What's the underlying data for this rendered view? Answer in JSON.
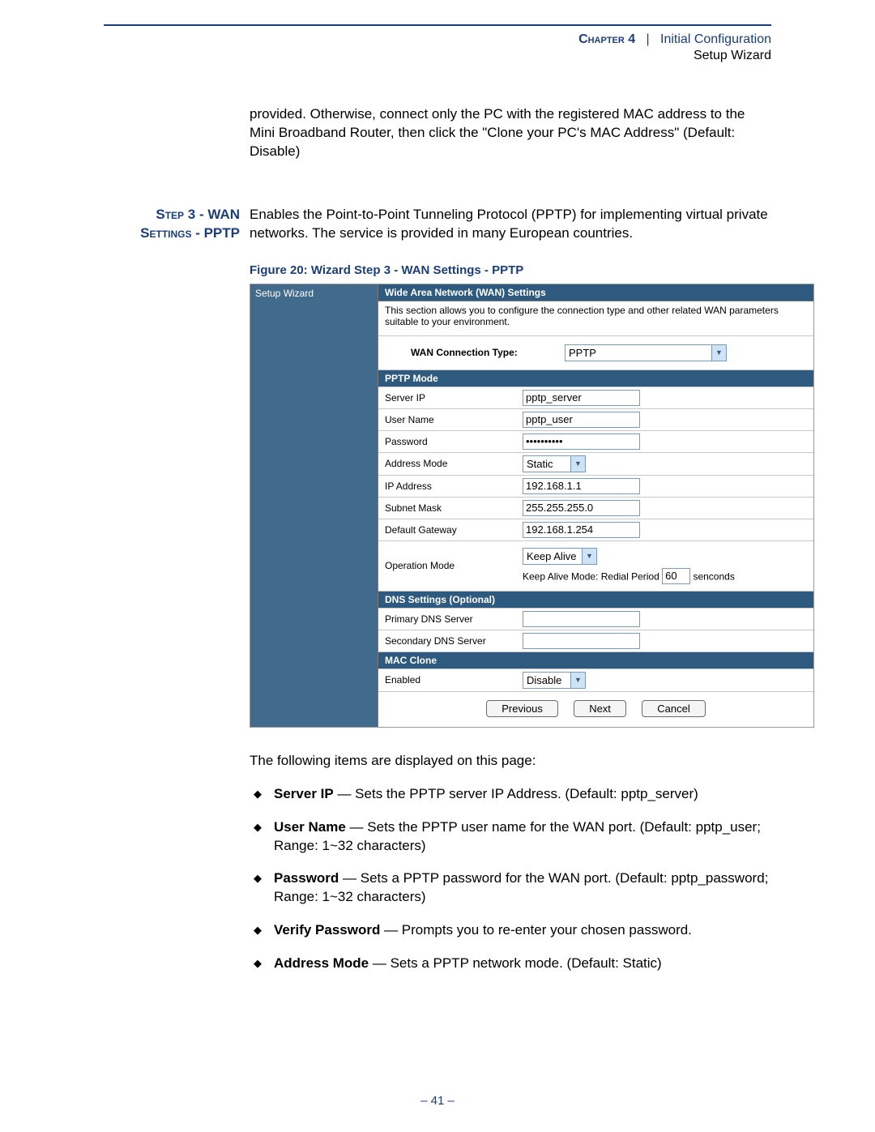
{
  "header": {
    "chapter_label": "Chapter 4",
    "chapter_sep": "|",
    "chapter_title": "Initial Configuration",
    "sub": "Setup Wizard"
  },
  "intro_para": "provided. Otherwise, connect only the PC with the registered MAC address to the Mini Broadband Router, then click the \"Clone your PC's MAC Address\" (Default: Disable)",
  "section": {
    "heading_line1": "Step 3 - WAN",
    "heading_line2": "Settings - PPTP",
    "body": "Enables the Point-to-Point Tunneling Protocol (PPTP) for implementing virtual private networks. The service is provided in many European countries."
  },
  "figure_caption": "Figure 20:  Wizard Step 3 - WAN Settings - PPTP",
  "screenshot": {
    "sidebar": "Setup Wizard",
    "title": "Wide Area Network (WAN) Settings",
    "desc": "This section allows you to configure the connection type and other related WAN parameters suitable to your environment.",
    "wan_label": "WAN Connection Type:",
    "wan_value": "PPTP",
    "pptp_hdr": "PPTP Mode",
    "rows": {
      "server_ip_lbl": "Server IP",
      "server_ip_val": "pptp_server",
      "user_name_lbl": "User Name",
      "user_name_val": "pptp_user",
      "password_lbl": "Password",
      "password_val": "••••••••••",
      "addr_mode_lbl": "Address Mode",
      "addr_mode_val": "Static",
      "ip_addr_lbl": "IP Address",
      "ip_addr_val": "192.168.1.1",
      "subnet_lbl": "Subnet Mask",
      "subnet_val": "255.255.255.0",
      "gateway_lbl": "Default Gateway",
      "gateway_val": "192.168.1.254",
      "op_mode_lbl": "Operation Mode",
      "op_mode_sel": "Keep Alive",
      "op_mode_text1": "Keep Alive Mode: Redial Period ",
      "op_mode_val": "60",
      "op_mode_text2": " senconds"
    },
    "dns_hdr": "DNS Settings (Optional)",
    "dns1_lbl": "Primary DNS Server",
    "dns2_lbl": "Secondary DNS Server",
    "mac_hdr": "MAC Clone",
    "mac_enabled_lbl": "Enabled",
    "mac_enabled_val": "Disable",
    "btn_prev": "Previous",
    "btn_next": "Next",
    "btn_cancel": "Cancel"
  },
  "after_text": "The following items are displayed on this page:",
  "bullets": [
    {
      "b": "Server IP",
      "t": " — Sets the PPTP server IP Address. (Default: pptp_server)"
    },
    {
      "b": "User Name",
      "t": " — Sets the PPTP user name for the WAN port. (Default: pptp_user; Range: 1~32 characters)"
    },
    {
      "b": "Password",
      "t": " — Sets a PPTP password for the WAN port. (Default: pptp_password; Range: 1~32 characters)"
    },
    {
      "b": "Verify Password",
      "t": " — Prompts you to re-enter your chosen password."
    },
    {
      "b": "Address Mode",
      "t": " — Sets a PPTP network mode. (Default: Static)"
    }
  ],
  "page_num": "–  41  –"
}
